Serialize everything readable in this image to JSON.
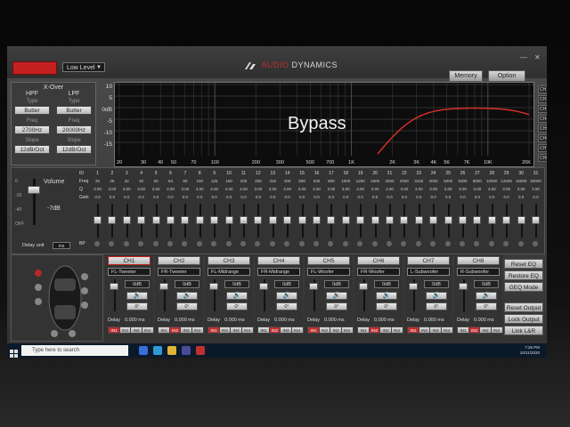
{
  "titlebar": {
    "level_label": "Low Level",
    "brand_prefix": "A",
    "brand_name": "DYNAMICS",
    "brand_red": "AUDIO",
    "memory": "Memory",
    "option": "Option"
  },
  "xover": {
    "title": "X-Over",
    "hpf_label": "HPF",
    "lpf_label": "LPF",
    "type_label": "Type",
    "freq_label": "Freq",
    "slope_label": "Slope",
    "hpf_type": "Butter",
    "lpf_type": "Butter",
    "hpf_freq": "2700Hz",
    "lpf_freq": "20000Hz",
    "hpf_slope": "12dB/Oct",
    "lpf_slope": "12dB/Oct"
  },
  "graph": {
    "yticks": [
      "10",
      "5",
      "0dB",
      "-5",
      "-10",
      "-15"
    ],
    "xticks": [
      "20",
      "30",
      "40",
      "50",
      "70",
      "100",
      "200",
      "300",
      "500",
      "700",
      "1K",
      "2K",
      "3K",
      "4K",
      "5K",
      "7K",
      "10K",
      "20K"
    ],
    "overlay": "Bypass",
    "curve_color": "#e0302a"
  },
  "channels_side": [
    "CH1",
    "CH2",
    "CH3",
    "CH4",
    "CH5",
    "CH6",
    "CH7",
    "CH8"
  ],
  "eq": {
    "volume_label": "Volume",
    "volume_value": "-7dB",
    "scale": [
      "0",
      "-20",
      "-40",
      "OFF"
    ],
    "delay_unit_label": "Delay unit",
    "delay_unit_value": "ms",
    "row_labels": [
      "ID",
      "Freq",
      "Q",
      "Gain",
      "BP"
    ],
    "bands": [
      {
        "id": "1",
        "freq": "20",
        "q": "3.00",
        "gain": "0.0"
      },
      {
        "id": "2",
        "freq": "25",
        "q": "3.00",
        "gain": "0.0"
      },
      {
        "id": "3",
        "freq": "32",
        "q": "3.00",
        "gain": "0.0"
      },
      {
        "id": "4",
        "freq": "40",
        "q": "3.00",
        "gain": "0.0"
      },
      {
        "id": "5",
        "freq": "50",
        "q": "3.00",
        "gain": "0.0"
      },
      {
        "id": "6",
        "freq": "63",
        "q": "3.00",
        "gain": "0.0"
      },
      {
        "id": "7",
        "freq": "80",
        "q": "3.00",
        "gain": "0.0"
      },
      {
        "id": "8",
        "freq": "100",
        "q": "3.00",
        "gain": "0.0"
      },
      {
        "id": "9",
        "freq": "125",
        "q": "3.00",
        "gain": "0.0"
      },
      {
        "id": "10",
        "freq": "160",
        "q": "3.00",
        "gain": "0.0"
      },
      {
        "id": "11",
        "freq": "200",
        "q": "3.00",
        "gain": "0.0"
      },
      {
        "id": "12",
        "freq": "250",
        "q": "3.00",
        "gain": "0.0"
      },
      {
        "id": "13",
        "freq": "315",
        "q": "3.00",
        "gain": "0.0"
      },
      {
        "id": "14",
        "freq": "400",
        "q": "3.00",
        "gain": "0.0"
      },
      {
        "id": "15",
        "freq": "500",
        "q": "3.00",
        "gain": "0.0"
      },
      {
        "id": "16",
        "freq": "630",
        "q": "3.00",
        "gain": "0.0"
      },
      {
        "id": "17",
        "freq": "800",
        "q": "3.00",
        "gain": "0.0"
      },
      {
        "id": "18",
        "freq": "1000",
        "q": "3.00",
        "gain": "0.0"
      },
      {
        "id": "19",
        "freq": "1250",
        "q": "3.00",
        "gain": "0.0"
      },
      {
        "id": "20",
        "freq": "1600",
        "q": "3.00",
        "gain": "0.0"
      },
      {
        "id": "21",
        "freq": "2000",
        "q": "3.00",
        "gain": "0.0"
      },
      {
        "id": "22",
        "freq": "2500",
        "q": "3.00",
        "gain": "0.0"
      },
      {
        "id": "23",
        "freq": "3150",
        "q": "3.00",
        "gain": "0.0"
      },
      {
        "id": "24",
        "freq": "4000",
        "q": "3.00",
        "gain": "0.0"
      },
      {
        "id": "25",
        "freq": "5000",
        "q": "3.00",
        "gain": "0.0"
      },
      {
        "id": "26",
        "freq": "6300",
        "q": "3.00",
        "gain": "0.0"
      },
      {
        "id": "27",
        "freq": "8000",
        "q": "3.00",
        "gain": "0.0"
      },
      {
        "id": "28",
        "freq": "10000",
        "q": "3.00",
        "gain": "0.0"
      },
      {
        "id": "29",
        "freq": "12500",
        "q": "3.00",
        "gain": "0.0"
      },
      {
        "id": "30",
        "freq": "16000",
        "q": "3.00",
        "gain": "0.0"
      },
      {
        "id": "31",
        "freq": "20000",
        "q": "3.00",
        "gain": "0.0"
      }
    ]
  },
  "channels": [
    {
      "label": "CH1",
      "name": "FL-Tweeter",
      "gain": "0dB",
      "phase": "0°",
      "delay": "0.000 ms",
      "inputs": [
        "IN1",
        "IN2",
        "IN3",
        "IN4"
      ],
      "active": 0
    },
    {
      "label": "CH2",
      "name": "FR-Tweeter",
      "gain": "0dB",
      "phase": "0°",
      "delay": "0.000 ms",
      "inputs": [
        "IN1",
        "IN2",
        "IN3",
        "IN4"
      ],
      "active": 1
    },
    {
      "label": "CH3",
      "name": "FL-Midrange",
      "gain": "0dB",
      "phase": "0°",
      "delay": "0.000 ms",
      "inputs": [
        "IN1",
        "IN2",
        "IN3",
        "IN4"
      ],
      "active": 0
    },
    {
      "label": "CH4",
      "name": "FR-Midrange",
      "gain": "0dB",
      "phase": "0°",
      "delay": "0.000 ms",
      "inputs": [
        "IN1",
        "IN2",
        "IN3",
        "IN4"
      ],
      "active": 1
    },
    {
      "label": "CH5",
      "name": "FL-Woofer",
      "gain": "0dB",
      "phase": "0°",
      "delay": "0.000 ms",
      "inputs": [
        "IN1",
        "IN2",
        "IN3",
        "IN4"
      ],
      "active": 0
    },
    {
      "label": "CH6",
      "name": "FR-Woofer",
      "gain": "0dB",
      "phase": "0°",
      "delay": "0.000 ms",
      "inputs": [
        "IN1",
        "IN2",
        "IN3",
        "IN4"
      ],
      "active": 1
    },
    {
      "label": "CH7",
      "name": "L-Subwoofer",
      "gain": "0dB",
      "phase": "0°",
      "delay": "0.000 ms",
      "inputs": [
        "IN1",
        "IN2",
        "IN3",
        "IN4"
      ],
      "active": 0
    },
    {
      "label": "CH8",
      "name": "R-Subwoofer",
      "gain": "0dB",
      "phase": "0°",
      "delay": "0.000 ms",
      "inputs": [
        "IN1",
        "IN2",
        "IN3",
        "IN4"
      ],
      "active": 1
    }
  ],
  "delay_label": "Delay",
  "side_buttons": [
    "Reset EQ",
    "Restore EQ",
    "GEQ Mode",
    "Reset Output",
    "Lock Output",
    "Link L&R"
  ],
  "taskbar": {
    "search_placeholder": "Type here to search",
    "time": "7:26 PM",
    "date": "10/11/2020"
  }
}
